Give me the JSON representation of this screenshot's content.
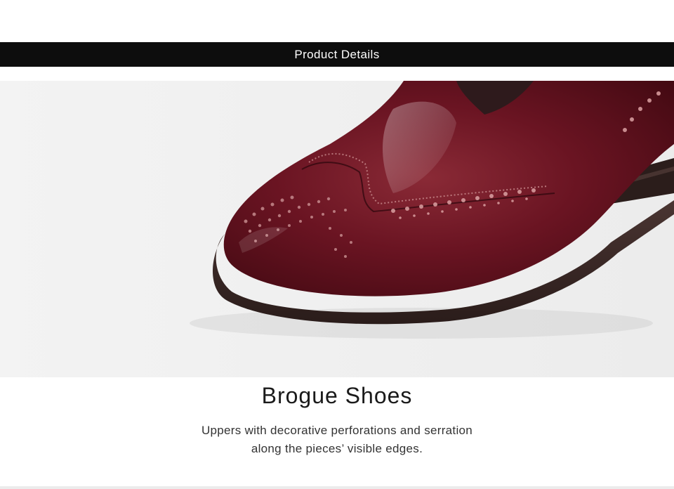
{
  "header": {
    "title": "Product Details"
  },
  "photo": {
    "subject": "shoe-photo",
    "colors": {
      "background": "#f1f1f1",
      "leather": "#5a0f1c",
      "sole": "#3a2a28"
    }
  },
  "feature": {
    "title": "Brogue Shoes",
    "description_line1": "Uppers with decorative perforations and serration",
    "description_line2": "along the pieces’ visible edges."
  }
}
